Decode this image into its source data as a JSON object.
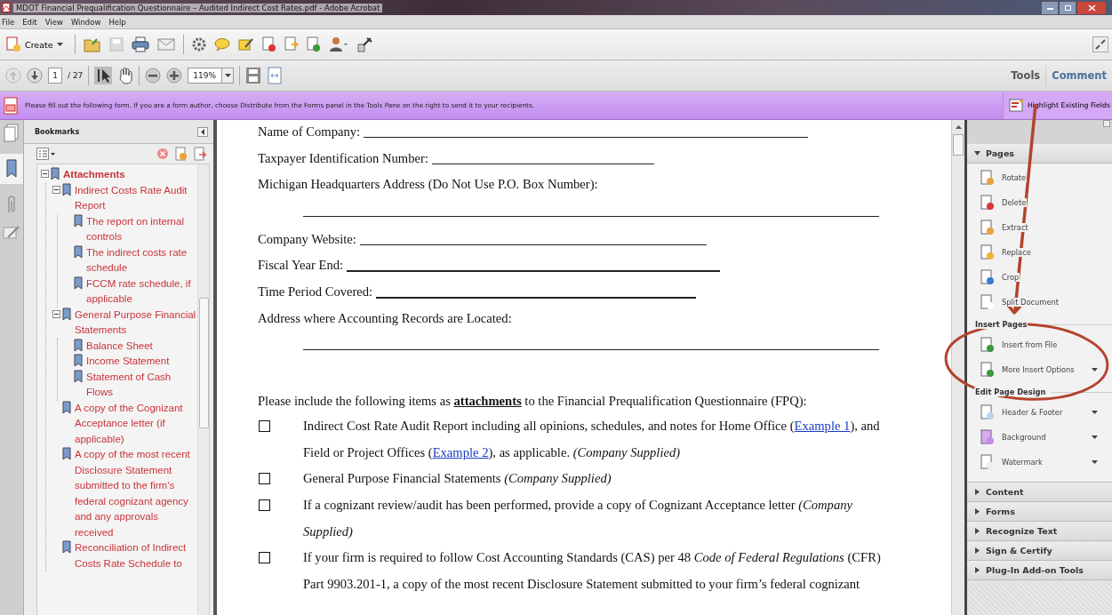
{
  "window": {
    "title": "MDOT Financial Prequalification Questionnaire – Audited Indirect Cost Rates.pdf - Adobe Acrobat"
  },
  "menu": [
    "File",
    "Edit",
    "View",
    "Window",
    "Help"
  ],
  "toolbar": {
    "create": "Create"
  },
  "nav": {
    "page": "1",
    "total": "/ 27",
    "zoom": "119%"
  },
  "tabs": [
    {
      "label": "Tools",
      "selected": true
    },
    {
      "label": "Comment",
      "selected": false
    }
  ],
  "form_bar": {
    "message": "Please fill out the following form. If you are a form author, choose Distribute from the Forms panel in the Tools Pane on the right to send it to your recipients.",
    "button": "Highlight Existing Fields"
  },
  "bookmarks": {
    "title": "Bookmarks",
    "tree": [
      {
        "label": "Attachments",
        "expanded": true,
        "children": [
          {
            "label": "Indirect Costs Rate Audit Report",
            "expanded": true,
            "children": [
              {
                "label": "The report on internal controls"
              },
              {
                "label": "The indirect costs rate schedule"
              },
              {
                "label": "FCCM rate schedule, if applicable"
              }
            ]
          },
          {
            "label": "General Purpose Financial Statements",
            "expanded": true,
            "children": [
              {
                "label": "Balance Sheet"
              },
              {
                "label": "Income Statement"
              },
              {
                "label": "Statement of Cash Flows"
              }
            ]
          },
          {
            "label": "A copy of the Cognizant Acceptance letter (if applicable)"
          },
          {
            "label": "A copy of the most recent Disclosure Statement submitted to the firm's federal cognizant agency and any approvals received"
          },
          {
            "label": "Reconciliation of Indirect Costs Rate Schedule to"
          }
        ]
      }
    ]
  },
  "document": {
    "fields": [
      {
        "label": "Name of Company:",
        "kind": "inline"
      },
      {
        "label": "Taxpayer Identification Number:",
        "kind": "inline"
      },
      {
        "label": "Michigan Headquarters Address (Do Not Use P.O. Box Number):",
        "kind": "below"
      },
      {
        "label": "Company Website:",
        "kind": "inline"
      },
      {
        "label": "Fiscal Year End:",
        "kind": "inline"
      },
      {
        "label": "Time Period Covered:",
        "kind": "inline"
      },
      {
        "label": "Address where Accounting Records are Located:",
        "kind": "below"
      }
    ],
    "intro": "Please include the following items as **attachments** to the Financial Prequalification Questionnaire (FPQ):",
    "items": [
      {
        "checked": false,
        "segments": [
          {
            "kind": "text",
            "text": "Indirect Cost Rate Audit Report including all opinions, schedules, and notes for Home Office ("
          },
          {
            "kind": "link",
            "text": "Example 1"
          },
          {
            "kind": "text",
            "text": "), and Field or Project Offices ("
          },
          {
            "kind": "link",
            "text": "Example 2"
          },
          {
            "kind": "text",
            "text": "), as applicable. *(Company Supplied)*"
          }
        ]
      },
      {
        "checked": false,
        "segments": [
          {
            "kind": "text",
            "text": "General Purpose Financial Statements *(Company Supplied)*"
          }
        ]
      },
      {
        "checked": false,
        "segments": [
          {
            "kind": "text",
            "text": "If a cognizant review/audit has been performed, provide a copy of Cognizant Acceptance letter *(Company Supplied)*"
          }
        ]
      },
      {
        "checked": false,
        "segments": [
          {
            "kind": "text",
            "text": "If your firm is required to follow Cost Accounting Standards (CAS) per 48 *Code of Federal Regulations* (CFR) Part 9903.201-1, a copy of the most recent Disclosure Statement submitted to your firm’s federal cognizant"
          }
        ]
      }
    ]
  },
  "tools_pane": {
    "sections": [
      {
        "title": "Pages",
        "expanded": true,
        "groups": [
          {
            "items": [
              {
                "label": "Rotate",
                "menu": false
              },
              {
                "label": "Delete",
                "menu": false
              },
              {
                "label": "Extract",
                "menu": false
              },
              {
                "label": "Replace",
                "menu": false
              },
              {
                "label": "Crop",
                "menu": false
              },
              {
                "label": "Split Document",
                "menu": false
              }
            ]
          },
          {
            "title": "Insert Pages",
            "items": [
              {
                "label": "Insert from File",
                "menu": false
              },
              {
                "label": "More Insert Options",
                "menu": true
              }
            ]
          },
          {
            "title": "Edit Page Design",
            "items": [
              {
                "label": "Header & Footer",
                "menu": true
              },
              {
                "label": "Background",
                "menu": true
              },
              {
                "label": "Watermark",
                "menu": true
              }
            ]
          }
        ]
      },
      {
        "title": "Content",
        "expanded": false
      },
      {
        "title": "Forms",
        "expanded": false
      },
      {
        "title": "Recognize Text",
        "expanded": false
      },
      {
        "title": "Sign & Certify",
        "expanded": false
      },
      {
        "title": "Plug-In Add-on Tools",
        "expanded": false
      }
    ]
  }
}
